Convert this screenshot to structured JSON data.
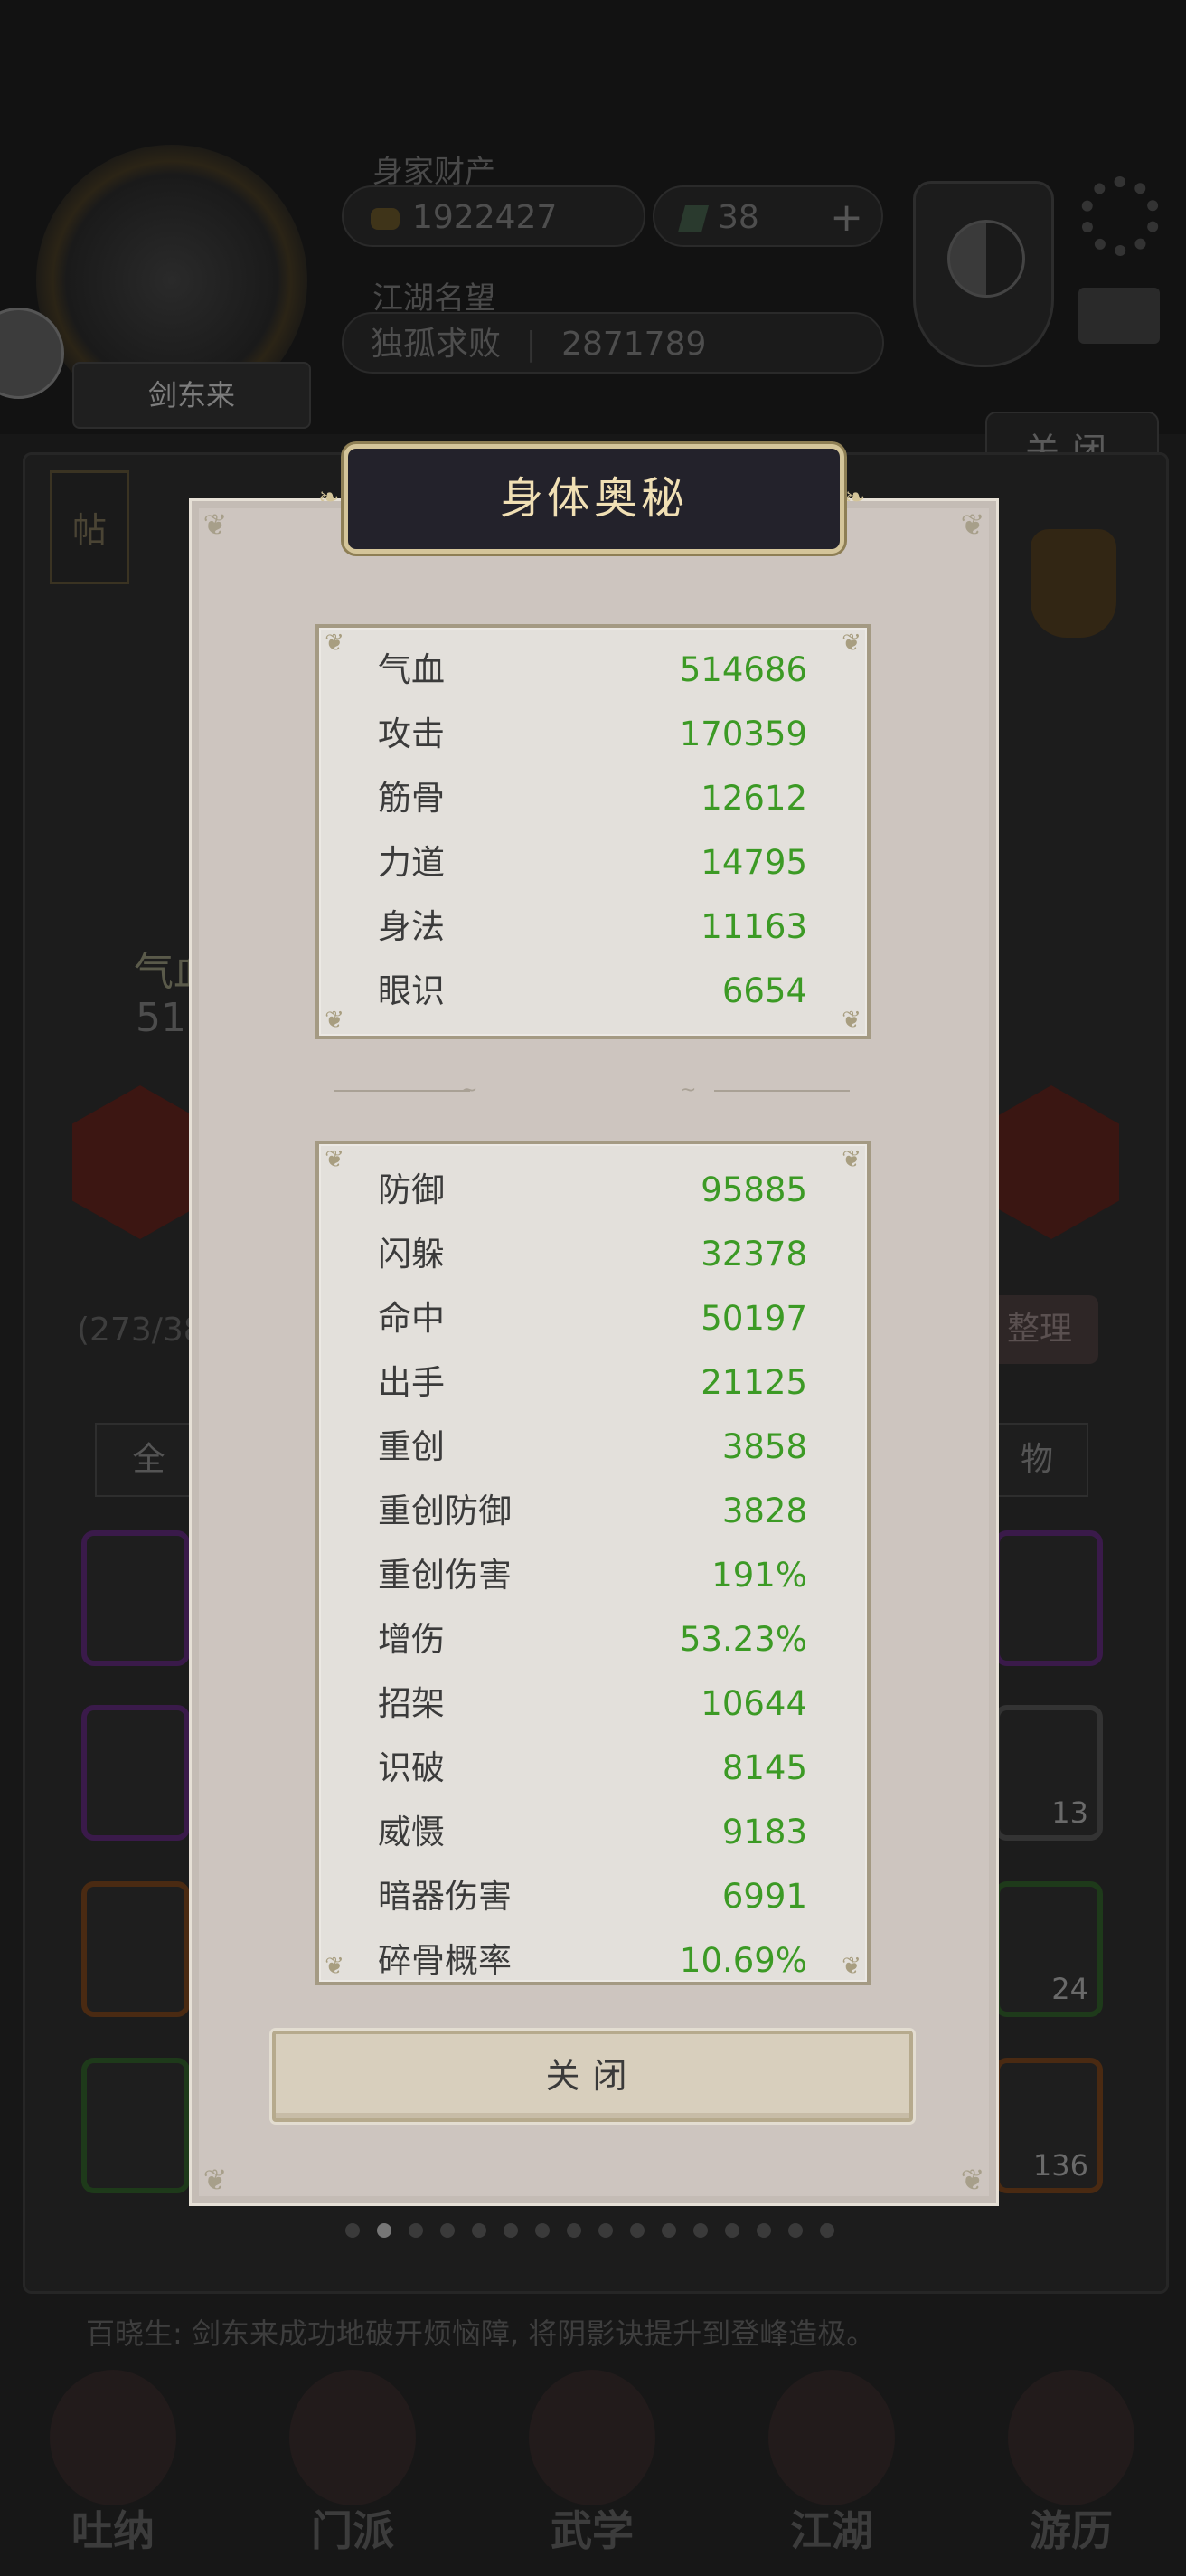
{
  "background": {
    "hero_name": "剑东来",
    "wealth_label": "身家财产",
    "coins": "1922427",
    "jade": "38",
    "plus": "+",
    "fame_label": "江湖名望",
    "fame_rank": "独孤求败",
    "fame_value": "2871789",
    "top_close": "关闭",
    "post_tag": "帖",
    "qixue_fragment": "气血",
    "qixue_num_fragment": "51",
    "inventory_count_fragment": "(273/38",
    "sort_button_fragment": "整理",
    "filter_all_fragment": "全",
    "filter_items_fragment": "物",
    "slot_counts": [
      "13",
      "24",
      "136"
    ],
    "news_ticker": "百晓生: 剑东来成功地破开烦恼障, 将阴影诀提升到登峰造极。",
    "nav": [
      "吐纳",
      "门派",
      "武学",
      "江湖",
      "游历"
    ]
  },
  "dialog": {
    "title": "身体奥秘",
    "primary_stats": [
      {
        "name": "气血",
        "value": "514686"
      },
      {
        "name": "攻击",
        "value": "170359"
      },
      {
        "name": "筋骨",
        "value": "12612"
      },
      {
        "name": "力道",
        "value": "14795"
      },
      {
        "name": "身法",
        "value": "11163"
      },
      {
        "name": "眼识",
        "value": "6654"
      }
    ],
    "secondary_stats": [
      {
        "name": "防御",
        "value": "95885"
      },
      {
        "name": "闪躲",
        "value": "32378"
      },
      {
        "name": "命中",
        "value": "50197"
      },
      {
        "name": "出手",
        "value": "21125"
      },
      {
        "name": "重创",
        "value": "3858"
      },
      {
        "name": "重创防御",
        "value": "3828"
      },
      {
        "name": "重创伤害",
        "value": "191%"
      },
      {
        "name": "增伤",
        "value": "53.23%"
      },
      {
        "name": "招架",
        "value": "10644"
      },
      {
        "name": "识破",
        "value": "8145"
      },
      {
        "name": "威慑",
        "value": "9183"
      },
      {
        "name": "暗器伤害",
        "value": "6991"
      },
      {
        "name": "碎骨概率",
        "value": "10.69%"
      }
    ],
    "close_label": "关闭"
  },
  "colors": {
    "stat_value": "#3c9a25",
    "stat_name": "#3b3b3b",
    "title_text": "#f0dfb4",
    "title_bg": "#23222b",
    "dialog_bg": "#cdc5bf"
  }
}
